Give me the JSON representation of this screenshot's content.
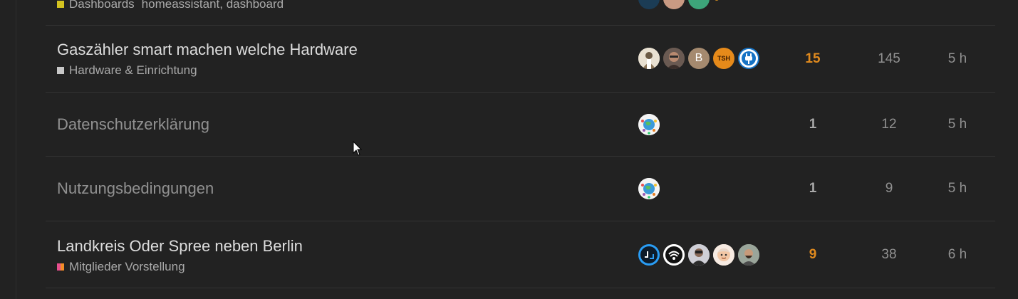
{
  "topics": [
    {
      "title": "",
      "category": "Dashboards",
      "category_color": "#d4c320",
      "tags": "homeassistant, dashboard"
    },
    {
      "title": "Gaszähler smart machen welche Hardware",
      "category": "Hardware & Einrichtung",
      "category_color": "#c8c8c8",
      "avatars": [
        {
          "name": "avatar-portrait-icon"
        },
        {
          "name": "avatar-photo-icon"
        },
        {
          "name": "avatar-letter",
          "letter": "B"
        },
        {
          "name": "avatar-monogram",
          "letter": "TSH"
        },
        {
          "name": "plug-icon"
        }
      ],
      "replies": "15",
      "views": "145",
      "activity": "5 h"
    },
    {
      "title": "Datenschutzerklärung",
      "replies": "1",
      "views": "12",
      "activity": "5 h"
    },
    {
      "title": "Nutzungsbedingungen",
      "replies": "1",
      "views": "9",
      "activity": "5 h"
    },
    {
      "title": "Landkreis Oder Spree neben Berlin",
      "category": "Mitglieder Vorstellung",
      "category_color": "#e84f8e",
      "category_color2": "#f28c28",
      "replies": "9",
      "views": "38",
      "activity": "6 h"
    }
  ],
  "colors": {
    "background": "#222222",
    "hot_replies": "#e08a1e"
  }
}
